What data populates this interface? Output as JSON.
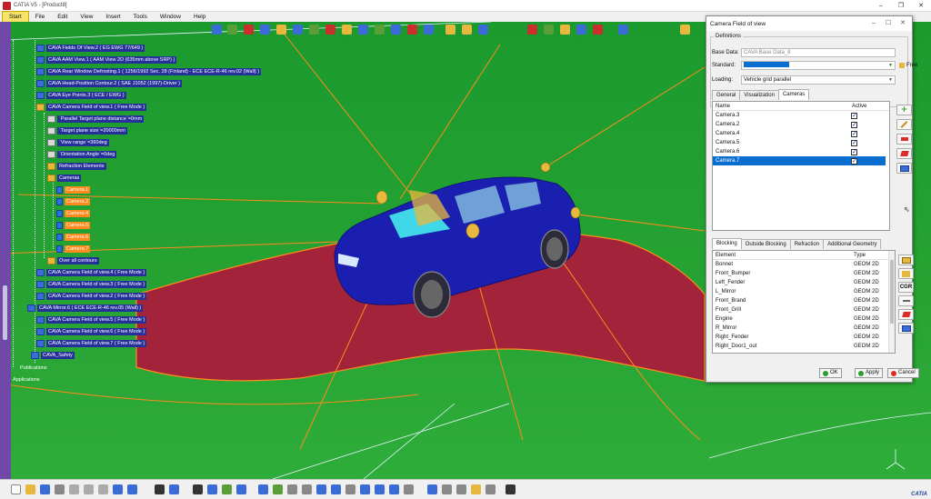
{
  "window": {
    "title": "CATIA V5 - [Product8]"
  },
  "menu": [
    "Start",
    "File",
    "Edit",
    "View",
    "Insert",
    "Tools",
    "Window",
    "Help"
  ],
  "tree": {
    "items": [
      {
        "label": "CAVA Fields Of View.2 ( EG EWG 77/649 )",
        "style": "blue"
      },
      {
        "label": "CAVA AAM View.1 ( AAM View 2D (635mm above SRP) )",
        "style": "blue"
      },
      {
        "label": "CAVA Rear Window Defrosting.1 ( 1256/1992 Sec. 28 (Finland) - ECE ECE-R-46 rev.02 (Wall) )",
        "style": "blue"
      },
      {
        "label": "CAVA Head-Position Contour.2 ( SAE J1052 (1997)-Driver )",
        "style": "blue"
      },
      {
        "label": "CAVA Eye Points.3 ( ECE / EWG )",
        "style": "blue"
      },
      {
        "label": "CAVA Camera Field of view.1 ( Free Mode )",
        "style": "blue"
      },
      {
        "label": "`Parallel Target plane distance`=0mm",
        "style": "blue"
      },
      {
        "label": "`Target plane size`=20000mm",
        "style": "blue"
      },
      {
        "label": "`View range`=360deg",
        "style": "blue"
      },
      {
        "label": "`Orientation Angle`=0deg",
        "style": "blue"
      },
      {
        "label": "Refraction Elements",
        "style": "blue"
      },
      {
        "label": "Cameras",
        "style": "blue"
      },
      {
        "label": "Camera.1",
        "style": "orange"
      },
      {
        "label": "Camera.2",
        "style": "orange"
      },
      {
        "label": "Camera.4",
        "style": "orange"
      },
      {
        "label": "Camera.5",
        "style": "orange"
      },
      {
        "label": "Camera.6",
        "style": "orange"
      },
      {
        "label": "Camera.7",
        "style": "orange"
      },
      {
        "label": "Over all contours",
        "style": "blue"
      },
      {
        "label": "CAVA Camera Field of view.4 ( Free Mode )",
        "style": "blue"
      },
      {
        "label": "CAVA Camera Field of view.3 ( Free Mode )",
        "style": "blue"
      },
      {
        "label": "CAVA Camera Field of view.2 ( Free Mode )",
        "style": "blue"
      },
      {
        "label": "CAVA Mirror.6 ( ECE ECE-R-46 rev.05 (Wall) )",
        "style": "blue"
      },
      {
        "label": "CAVA Camera Field of view.5 ( Free Mode )",
        "style": "blue"
      },
      {
        "label": "CAVA Camera Field of view.6 ( Free Mode )",
        "style": "blue"
      },
      {
        "label": "CAVA Camera Field of view.7 ( Free Mode )",
        "style": "blue"
      },
      {
        "label": "CAVA_Safety",
        "style": "blue"
      },
      {
        "label": "Publications",
        "style": "plain"
      },
      {
        "label": "Applications",
        "style": "plain"
      }
    ]
  },
  "dialog": {
    "title": "Camera Field of view",
    "group_title": "Definitions",
    "base_data_label": "Base Data:",
    "base_data_value": "CAVA Base Data_8",
    "standard_label": "Standard:",
    "free_label": "Free",
    "loading_label": "Loading:",
    "loading_value": "Vehicle grid parallel",
    "tabs": [
      "General",
      "Visualization",
      "Cameras"
    ],
    "camera_columns": [
      "Name",
      "Active"
    ],
    "cameras": [
      {
        "name": "Camera.3",
        "active": true
      },
      {
        "name": "Camera.2",
        "active": true
      },
      {
        "name": "Camera.4",
        "active": true
      },
      {
        "name": "Camera.5",
        "active": true
      },
      {
        "name": "Camera.6",
        "active": true
      },
      {
        "name": "Camera.7",
        "active": true
      }
    ],
    "blocking_tabs": [
      "Blocking",
      "Outside Blocking",
      "Refraction",
      "Additional Geometry"
    ],
    "element_columns": [
      "Element",
      "Type"
    ],
    "elements": [
      {
        "name": "Bonnet",
        "type": "GEOM 2D"
      },
      {
        "name": "Front_Bumper",
        "type": "GEOM 2D"
      },
      {
        "name": "Left_Fender",
        "type": "GEOM 2D"
      },
      {
        "name": "L_Mirror",
        "type": "GEOM 2D"
      },
      {
        "name": "Front_Brand",
        "type": "GEOM 2D"
      },
      {
        "name": "Front_Grill",
        "type": "GEOM 2D"
      },
      {
        "name": "Engine",
        "type": "GEOM 2D"
      },
      {
        "name": "R_Mirror",
        "type": "GEOM 2D"
      },
      {
        "name": "Right_Fender",
        "type": "GEOM 2D"
      },
      {
        "name": "Right_Door1_out",
        "type": "GEOM 2D"
      }
    ],
    "side_cgr": "CGR",
    "ok_label": "OK",
    "apply_label": "Apply",
    "cancel_label": "Cancel"
  },
  "logo": "CATIA",
  "colors": {
    "viewport_green": "#26a333",
    "ground_red": "#a3233a",
    "car_blue": "#1a1fb0",
    "contour_orange": "#ff8a1e",
    "selection_blue": "#0a6ed1"
  }
}
